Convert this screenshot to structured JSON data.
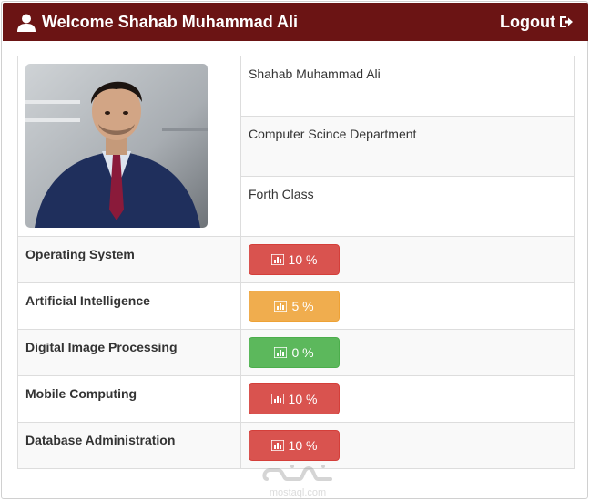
{
  "header": {
    "welcome_text": "Welcome Shahab Muhammad Ali",
    "logout_label": "Logout",
    "background": "#6b1414"
  },
  "profile": {
    "name": "Shahab Muhammad Ali",
    "department": "Computer Scince Department",
    "class": "Forth Class"
  },
  "subjects": [
    {
      "name": "Operating System",
      "grade": "10 %",
      "color": "#d9534f"
    },
    {
      "name": "Artificial Intelligence",
      "grade": "5 %",
      "color": "#f0ad4e"
    },
    {
      "name": "Digital Image Processing",
      "grade": "0 %",
      "color": "#5cb85c"
    },
    {
      "name": "Mobile Computing",
      "grade": "10 %",
      "color": "#d9534f"
    },
    {
      "name": "Database Administration",
      "grade": "10 %",
      "color": "#d9534f"
    }
  ],
  "watermark": {
    "text": "mostaql.com"
  }
}
